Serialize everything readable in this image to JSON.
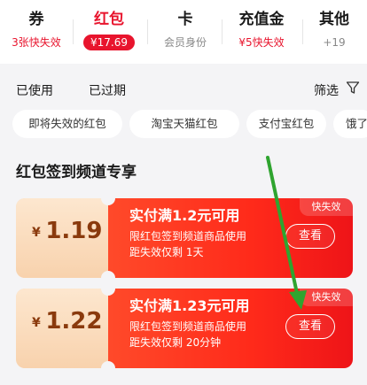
{
  "tabs": [
    {
      "title": "券",
      "sub": "3张快失效",
      "sub_red": true
    },
    {
      "title": "红包",
      "sub": "¥17.69",
      "active": true
    },
    {
      "title": "卡",
      "sub": "会员身份"
    },
    {
      "title": "充值金",
      "sub": "¥5快失效",
      "sub_red": true
    },
    {
      "title": "其他",
      "sub": "+19"
    }
  ],
  "filters": {
    "used": "已使用",
    "expired": "已过期",
    "screen": "筛选"
  },
  "chips": [
    "即将失效的红包",
    "淘宝天猫红包",
    "支付宝红包",
    "饿了"
  ],
  "section_title": "红包签到频道专享",
  "coupons": [
    {
      "currency": "¥",
      "amount": "1.19",
      "condition": "实付满1.2元可用",
      "desc": "限红包签到频道商品使用",
      "expire": "距失效仅剩 1天",
      "button": "查看",
      "tag": "快失效"
    },
    {
      "currency": "¥",
      "amount": "1.22",
      "condition": "实付满1.23元可用",
      "desc": "限红包签到频道商品使用",
      "expire": "距失效仅剩 20分钟",
      "button": "查看",
      "tag": "快失效"
    }
  ],
  "colors": {
    "accent": "#e8142d",
    "annotation_arrow": "#2fa42f"
  }
}
